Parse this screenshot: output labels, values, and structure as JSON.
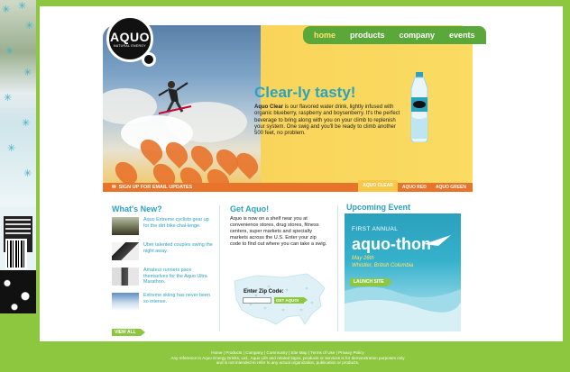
{
  "nav": {
    "items": [
      "home",
      "products",
      "company",
      "events"
    ],
    "active": "home"
  },
  "logo": {
    "word": "AQUO",
    "tagline": "NATURAL ENERGY"
  },
  "hero": {
    "headline": "Clear-ly tasty!",
    "brand_bold": "Aquo Clear",
    "body": " is our flavored water drink, lightly infused with organic blueberry, raspberry and boysenberry. It's the perfect beverage to bring along with you on your climb to replenish your system. One swig and you'll be ready to climb another 500 feet, no problem."
  },
  "bar": {
    "signup": "SIGN UP FOR EMAIL UPDATES",
    "tabs": [
      "AQUO CLEAR",
      "AQUO RED",
      "AQUO GREEN"
    ]
  },
  "whats_new": {
    "title": "What's New?",
    "items": [
      "Aquo Extreme cyclists gear up for the dirt bike chal-lenge.",
      "Uber talented couples swing the night away.",
      "Amateur runners pace themselves for the Aquo Ultra Marathon.",
      "Extreme skiing has never been so intense."
    ],
    "view_all": "VIEW ALL"
  },
  "get_aquo": {
    "title": "Get Aquo!",
    "text": "Aquo is now on a shelf near you at convenience stores, drug stores, fitness centers, super markets and specialty markets across the U.S. Enter your zip code to find out where you can take a swig.",
    "zip_label": "Enter Zip Code:",
    "zip_value": "",
    "button": "GET AQUO!"
  },
  "event": {
    "title": "Upcoming Event",
    "kicker": "FIRST ANNUAL",
    "name": "aquo-thon",
    "date": "May 26th",
    "location": "Whistler, British Columbia",
    "button": "LAUNCH SITE"
  },
  "footer": {
    "links": "Home | Products | Company | Community | Site Map | Terms of Use | Privacy Policy",
    "line2": "Any reference to Aquo Energy Drinks, Ltd., Aquo Life and related logos, products or services is for demonstration purposes only",
    "line3": "and is not intended to refer to any actual organization, publication or products."
  },
  "colors": {
    "brand_green": "#8dc63f",
    "nav_green": "#5aa83a",
    "accent_blue": "#2aa2c0",
    "orange": "#e8732b",
    "yellow": "#f7c84a"
  }
}
